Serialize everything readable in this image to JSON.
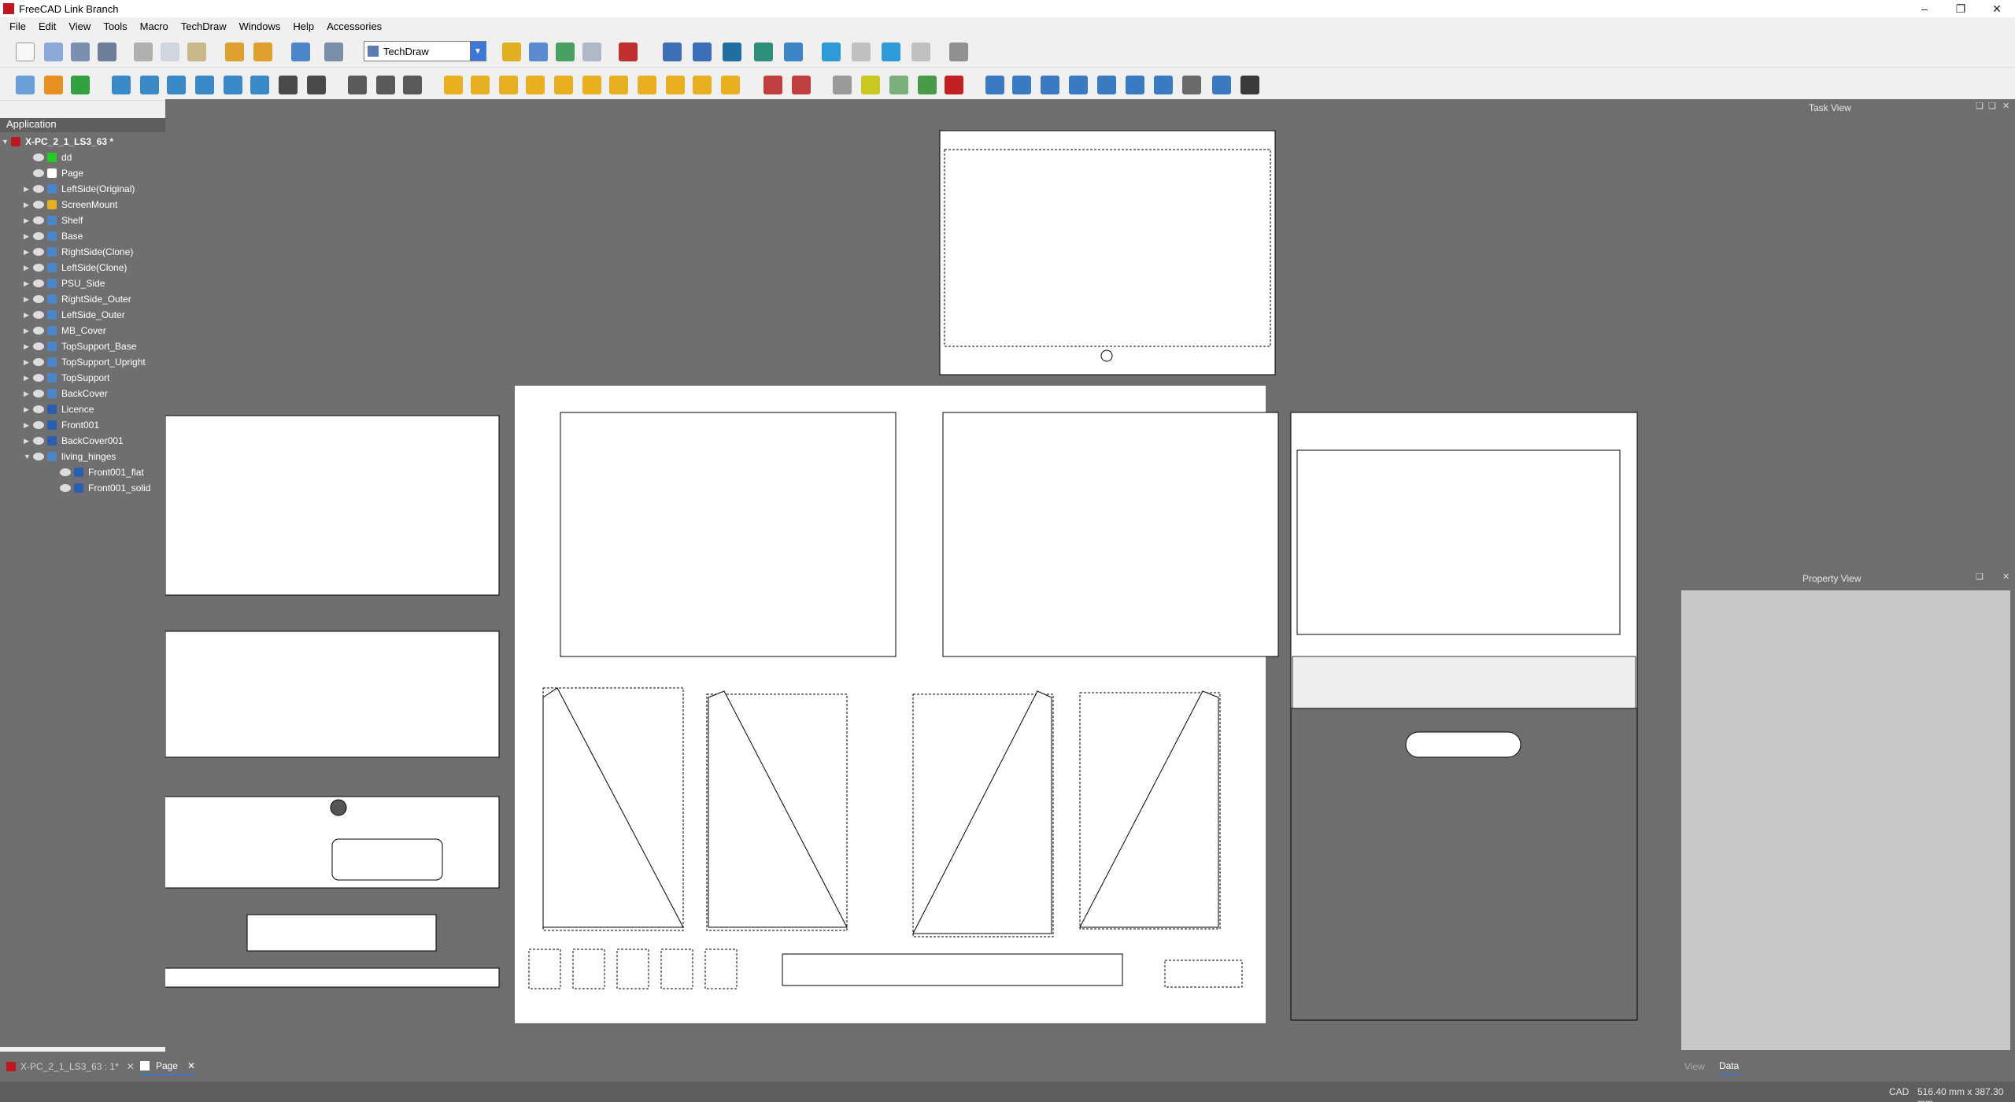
{
  "window": {
    "title": "FreeCAD Link Branch"
  },
  "menu": [
    "File",
    "Edit",
    "View",
    "Tools",
    "Macro",
    "TechDraw",
    "Windows",
    "Help",
    "Accessories"
  ],
  "workbench": {
    "selected": "TechDraw"
  },
  "tree": {
    "header": "Application",
    "root": "X-PC_2_1_LS3_63 *",
    "items": [
      {
        "label": "dd"
      },
      {
        "label": "Page"
      },
      {
        "label": "LeftSide(Original)"
      },
      {
        "label": "ScreenMount"
      },
      {
        "label": "Shelf"
      },
      {
        "label": "Base"
      },
      {
        "label": "RightSide(Clone)"
      },
      {
        "label": "LeftSide(Clone)"
      },
      {
        "label": "PSU_Side"
      },
      {
        "label": "RightSide_Outer"
      },
      {
        "label": "LeftSide_Outer"
      },
      {
        "label": "MB_Cover"
      },
      {
        "label": "TopSupport_Base"
      },
      {
        "label": "TopSupport_Upright"
      },
      {
        "label": "TopSupport"
      },
      {
        "label": "BackCover"
      },
      {
        "label": "Licence"
      },
      {
        "label": "Front001"
      },
      {
        "label": "BackCover001"
      },
      {
        "label": "living_hinges"
      },
      {
        "label": "Front001_flat"
      },
      {
        "label": "Front001_solid"
      }
    ]
  },
  "right": {
    "task_view": "Task View",
    "property_view": "Property View",
    "tab_view": "View",
    "tab_data": "Data"
  },
  "doctabs": {
    "doc": "X-PC_2_1_LS3_63 : 1*",
    "page": "Page"
  },
  "status": {
    "nav": "CAD",
    "dims": "516.40 mm x 387.30 mm"
  },
  "colors": {
    "canvas": "#6e6e6e",
    "accent": "#3c78d8",
    "tree_bg": "#6f6f6f"
  }
}
